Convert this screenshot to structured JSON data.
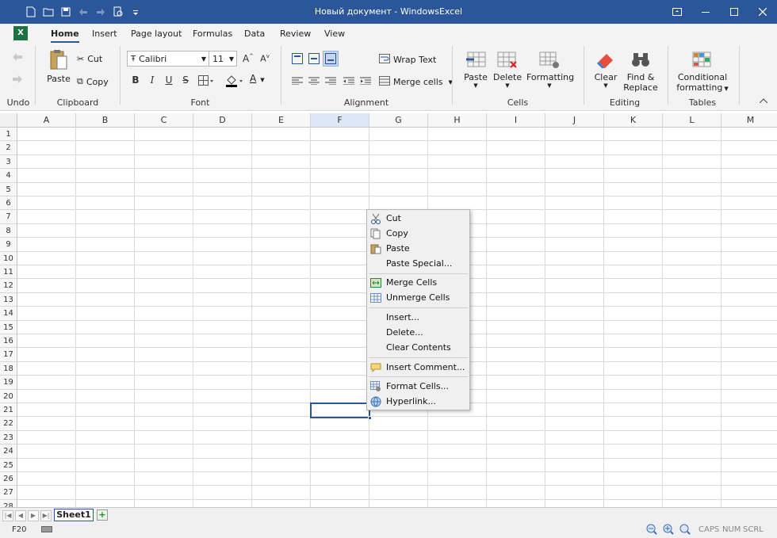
{
  "window": {
    "title": "Новый документ - WindowsExcel"
  },
  "ribbon": {
    "tabs": [
      "Home",
      "Insert",
      "Page layout",
      "Formulas",
      "Data",
      "Review",
      "View"
    ],
    "clipboard": {
      "undo": "Undo",
      "paste": "Paste",
      "cut": "Cut",
      "copy": "Copy",
      "label": "Clipboard"
    },
    "font": {
      "name": "Calibri",
      "size": "11",
      "label": "Font",
      "bold": "B",
      "italic": "I",
      "underline": "U",
      "strike": "S",
      "fontcolor": "A"
    },
    "alignment": {
      "wrap": "Wrap Text",
      "merge": "Merge cells",
      "label": "Alignment"
    },
    "cells": {
      "paste": "Paste",
      "delete": "Delete",
      "formatting": "Formatting",
      "label": "Cells"
    },
    "editing": {
      "clear": "Clear",
      "find": "Find &",
      "find2": "Replace",
      "label": "Editing"
    },
    "tables": {
      "cond": "Conditional",
      "cond2": "formatting",
      "label": "Tables"
    }
  },
  "grid": {
    "columns": [
      "A",
      "B",
      "C",
      "D",
      "E",
      "F",
      "G",
      "H",
      "I",
      "J",
      "K",
      "L",
      "M"
    ],
    "rows": [
      "1",
      "2",
      "3",
      "4",
      "5",
      "6",
      "7",
      "8",
      "9",
      "10",
      "11",
      "12",
      "13",
      "14",
      "15",
      "16",
      "17",
      "18",
      "19",
      "20",
      "21",
      "22",
      "23",
      "24",
      "25",
      "26",
      "27",
      "28"
    ],
    "selected_column": "F",
    "active_cell": "F21"
  },
  "context_menu": {
    "items": [
      {
        "label": "Cut",
        "icon": "scissors-icon"
      },
      {
        "label": "Copy",
        "icon": "copy-icon"
      },
      {
        "label": "Paste",
        "icon": "paste-icon"
      },
      {
        "label": "Paste Special...",
        "icon": ""
      },
      {
        "label": "Merge Cells",
        "icon": "merge-cells-icon"
      },
      {
        "label": "Unmerge Cells",
        "icon": "unmerge-cells-icon"
      },
      {
        "label": "Insert...",
        "icon": ""
      },
      {
        "label": "Delete...",
        "icon": ""
      },
      {
        "label": "Clear Contents",
        "icon": ""
      },
      {
        "label": "Insert Comment...",
        "icon": "comment-icon"
      },
      {
        "label": "Format Cells...",
        "icon": "format-cells-icon"
      },
      {
        "label": "Hyperlink...",
        "icon": "hyperlink-icon"
      }
    ]
  },
  "sheets": {
    "tabs": [
      "Sheet1"
    ]
  },
  "status": {
    "cell_ref": "F20",
    "caps": "CAPS",
    "num": "NUM",
    "scrl": "SCRL"
  },
  "colors": {
    "accent": "#2b579a",
    "title_bar": "#2b579a",
    "selection": "#dce8f6"
  }
}
